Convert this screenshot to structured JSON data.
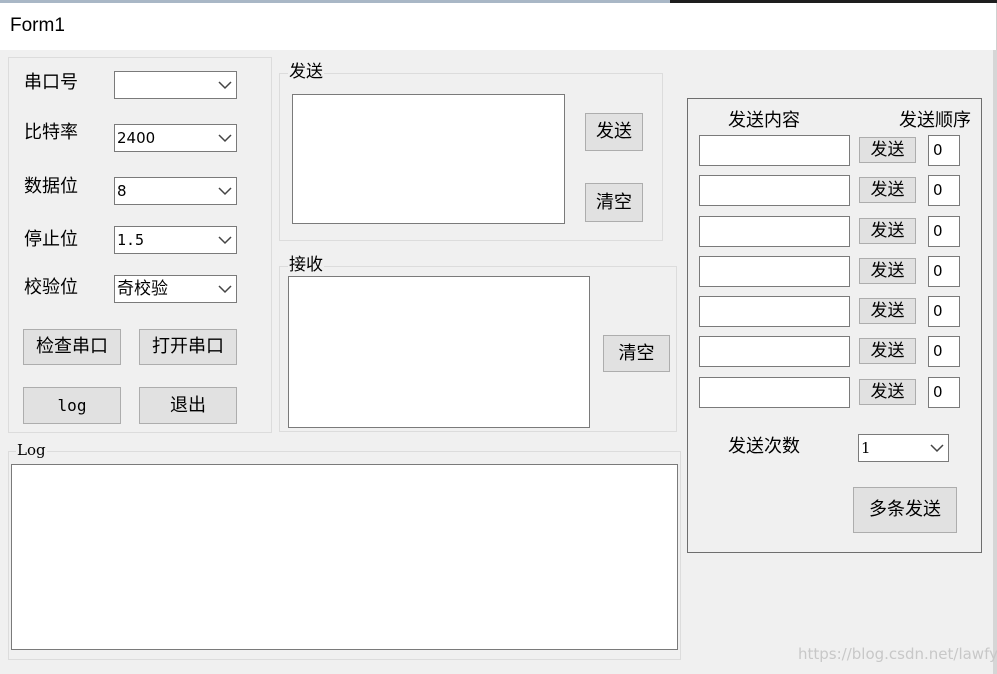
{
  "window": {
    "title": "Form1"
  },
  "serial": {
    "port_label": "串口号",
    "port_value": "",
    "baud_label": "比特率",
    "baud_value": "2400",
    "databits_label": "数据位",
    "databits_value": "8",
    "stopbits_label": "停止位",
    "stopbits_value": "1.5",
    "parity_label": "校验位",
    "parity_value": "奇校验",
    "check_button": "检查串口",
    "open_button": "打开串口",
    "log_button": "log",
    "exit_button": "退出"
  },
  "send": {
    "title": "发送",
    "send_button": "发送",
    "clear_button": "清空"
  },
  "receive": {
    "title": "接收",
    "clear_button": "清空"
  },
  "log": {
    "title": "Log"
  },
  "multi": {
    "content_header": "发送内容",
    "order_header": "发送顺序",
    "rows": [
      {
        "send_label": "发送",
        "order": "0"
      },
      {
        "send_label": "发送",
        "order": "0"
      },
      {
        "send_label": "发送",
        "order": "0"
      },
      {
        "send_label": "发送",
        "order": "0"
      },
      {
        "send_label": "发送",
        "order": "0"
      },
      {
        "send_label": "发送",
        "order": "0"
      },
      {
        "send_label": "发送",
        "order": "0"
      }
    ],
    "count_label": "发送次数",
    "count_value": "1",
    "multi_send_button": "多条发送"
  },
  "watermark": "https://blog.csdn.net/lawfy_"
}
